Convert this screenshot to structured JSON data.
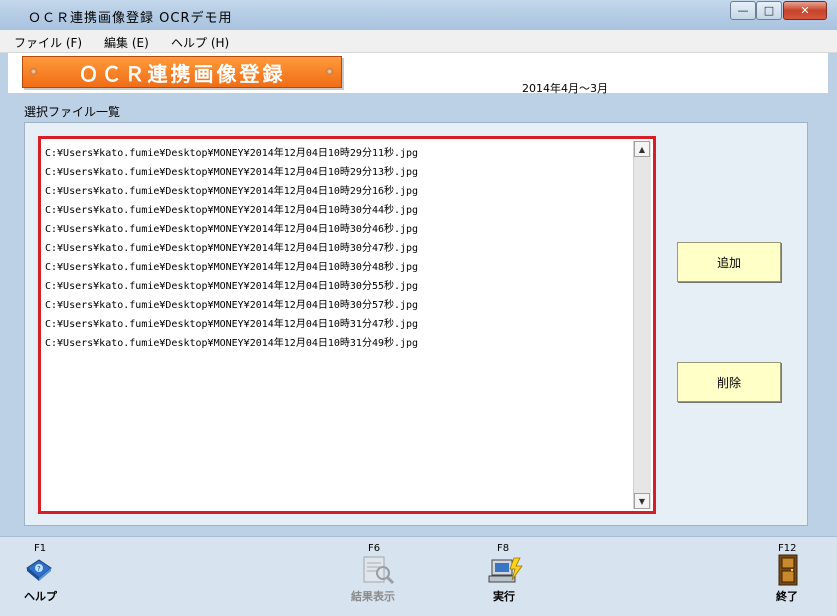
{
  "window": {
    "title": "ＯＣＲ連携画像登録 OCRデモ用",
    "minimize": "—",
    "maximize": "□",
    "close": "✕"
  },
  "menu": [
    {
      "label": "ファイル (F)"
    },
    {
      "label": "編集 (E)"
    },
    {
      "label": "ヘルプ (H)"
    }
  ],
  "header": {
    "title": "ＯＣＲ連携画像登録",
    "period": "2014年4月〜3月"
  },
  "section_label": "選択ファイル一覧",
  "files": [
    "C:¥Users¥kato.fumie¥Desktop¥MONEY¥2014年12月04日10時29分11秒.jpg",
    "C:¥Users¥kato.fumie¥Desktop¥MONEY¥2014年12月04日10時29分13秒.jpg",
    "C:¥Users¥kato.fumie¥Desktop¥MONEY¥2014年12月04日10時29分16秒.jpg",
    "C:¥Users¥kato.fumie¥Desktop¥MONEY¥2014年12月04日10時30分44秒.jpg",
    "C:¥Users¥kato.fumie¥Desktop¥MONEY¥2014年12月04日10時30分46秒.jpg",
    "C:¥Users¥kato.fumie¥Desktop¥MONEY¥2014年12月04日10時30分47秒.jpg",
    "C:¥Users¥kato.fumie¥Desktop¥MONEY¥2014年12月04日10時30分48秒.jpg",
    "C:¥Users¥kato.fumie¥Desktop¥MONEY¥2014年12月04日10時30分55秒.jpg",
    "C:¥Users¥kato.fumie¥Desktop¥MONEY¥2014年12月04日10時30分57秒.jpg",
    "C:¥Users¥kato.fumie¥Desktop¥MONEY¥2014年12月04日10時31分47秒.jpg",
    "C:¥Users¥kato.fumie¥Desktop¥MONEY¥2014年12月04日10時31分49秒.jpg"
  ],
  "buttons": {
    "add": "追加",
    "delete": "削除"
  },
  "footer": {
    "help": {
      "key": "F1",
      "label": "ヘルプ",
      "icon": "help-book-icon"
    },
    "result": {
      "key": "F6",
      "label": "結果表示",
      "icon": "magnifier-document-icon",
      "enabled": false
    },
    "execute": {
      "key": "F8",
      "label": "実行",
      "icon": "computer-execute-icon"
    },
    "exit": {
      "key": "F12",
      "label": "終了",
      "icon": "exit-door-icon"
    }
  },
  "colors": {
    "accent_orange": "#f06d16",
    "list_border": "#d61f26",
    "button_fill": "#ffffc8"
  }
}
